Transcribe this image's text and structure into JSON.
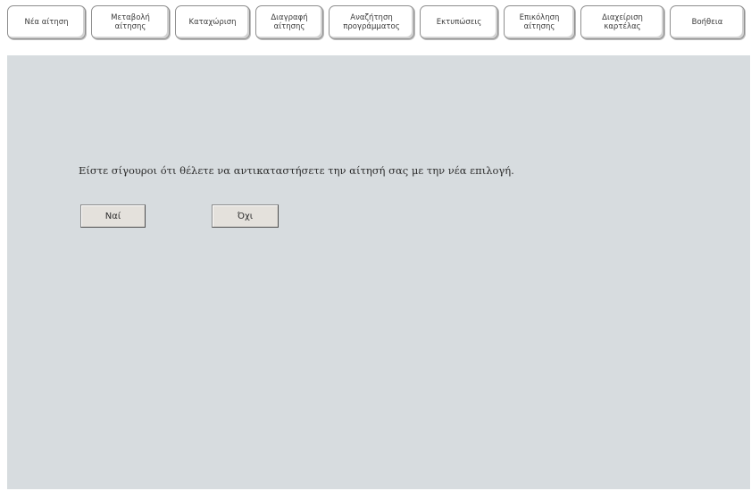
{
  "toolbar": {
    "tabs": [
      {
        "label": "Νέα αίτηση"
      },
      {
        "label": "Μεταβολή\nαίτησης"
      },
      {
        "label": "Καταχώριση"
      },
      {
        "label": "Διαγραφή\nαίτησης"
      },
      {
        "label": "Αναζήτηση\nπρογράμματος"
      },
      {
        "label": "Εκτυπώσεις"
      },
      {
        "label": "Επικόληση\nαίτησης"
      },
      {
        "label": "Διαχείριση\nκαρτέλας"
      },
      {
        "label": "Βοήθεια"
      }
    ]
  },
  "dialog": {
    "message": "Είστε σίγουροι ότι θέλετε να αντικαταστήσετε την αίτησή σας με την νέα επιλογή.",
    "yes_label": "Ναί",
    "no_label": "Όχι"
  },
  "colors": {
    "content_background": "#d7dcdf",
    "button_background": "#e4e1dc"
  }
}
